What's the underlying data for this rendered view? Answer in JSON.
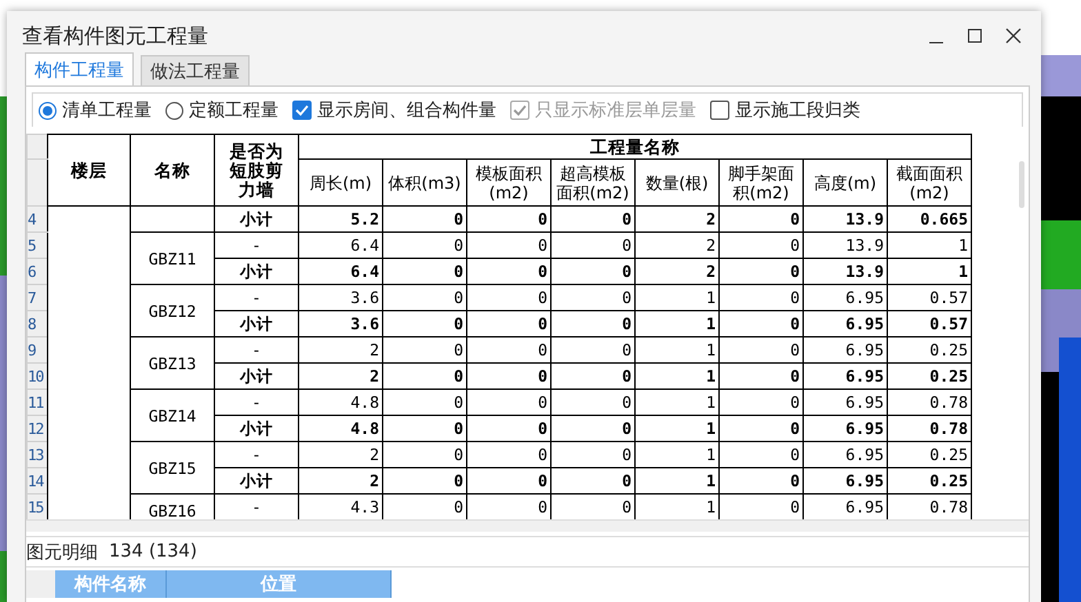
{
  "window": {
    "title": "查看构件图元工程量"
  },
  "tabs": [
    {
      "label": "构件工程量",
      "selected": true
    },
    {
      "label": "做法工程量",
      "selected": false
    }
  ],
  "options": [
    {
      "kind": "radio",
      "label": "清单工程量",
      "checked": true,
      "disabled": false
    },
    {
      "kind": "radio",
      "label": "定额工程量",
      "checked": false,
      "disabled": false
    },
    {
      "kind": "checkbox",
      "label": "显示房间、组合构件量",
      "checked": true,
      "disabled": false
    },
    {
      "kind": "checkbox",
      "label": "只显示标准层单层量",
      "checked": true,
      "disabled": true
    },
    {
      "kind": "checkbox",
      "label": "显示施工段归类",
      "checked": false,
      "disabled": false
    }
  ],
  "table": {
    "fixed_columns": [
      "楼层",
      "名称",
      "是否为短肢剪力墙"
    ],
    "group_heading": "工程量名称",
    "columns": [
      "周长(m)",
      "体积(m3)",
      "模板面积(m2)",
      "超高模板面积(m2)",
      "数量(根)",
      "脚手架面积(m2)",
      "高度(m)",
      "截面面积(m2)"
    ],
    "groups": [
      {
        "rows": [
          {
            "number": "4",
            "kind": "subtotal",
            "type": "小计",
            "values": [
              "5.2",
              "0",
              "0",
              "0",
              "2",
              "0",
              "13.9",
              "0.665"
            ]
          }
        ]
      },
      {
        "name": "GBZ11",
        "rows": [
          {
            "number": "5",
            "kind": "item",
            "type": "-",
            "values": [
              "6.4",
              "0",
              "0",
              "0",
              "2",
              "0",
              "13.9",
              "1"
            ]
          },
          {
            "number": "6",
            "kind": "subtotal",
            "type": "小计",
            "values": [
              "6.4",
              "0",
              "0",
              "0",
              "2",
              "0",
              "13.9",
              "1"
            ]
          }
        ]
      },
      {
        "name": "GBZ12",
        "rows": [
          {
            "number": "7",
            "kind": "item",
            "type": "-",
            "values": [
              "3.6",
              "0",
              "0",
              "0",
              "1",
              "0",
              "6.95",
              "0.57"
            ]
          },
          {
            "number": "8",
            "kind": "subtotal",
            "type": "小计",
            "values": [
              "3.6",
              "0",
              "0",
              "0",
              "1",
              "0",
              "6.95",
              "0.57"
            ]
          }
        ]
      },
      {
        "name": "GBZ13",
        "rows": [
          {
            "number": "9",
            "kind": "item",
            "type": "-",
            "values": [
              "2",
              "0",
              "0",
              "0",
              "1",
              "0",
              "6.95",
              "0.25"
            ]
          },
          {
            "number": "10",
            "kind": "subtotal",
            "type": "小计",
            "values": [
              "2",
              "0",
              "0",
              "0",
              "1",
              "0",
              "6.95",
              "0.25"
            ]
          }
        ]
      },
      {
        "name": "GBZ14",
        "rows": [
          {
            "number": "11",
            "kind": "item",
            "type": "-",
            "values": [
              "4.8",
              "0",
              "0",
              "0",
              "1",
              "0",
              "6.95",
              "0.78"
            ]
          },
          {
            "number": "12",
            "kind": "subtotal",
            "type": "小计",
            "values": [
              "4.8",
              "0",
              "0",
              "0",
              "1",
              "0",
              "6.95",
              "0.78"
            ]
          }
        ]
      },
      {
        "name": "GBZ15",
        "rows": [
          {
            "number": "13",
            "kind": "item",
            "type": "-",
            "values": [
              "2",
              "0",
              "0",
              "0",
              "1",
              "0",
              "6.95",
              "0.25"
            ]
          },
          {
            "number": "14",
            "kind": "subtotal",
            "type": "小计",
            "values": [
              "2",
              "0",
              "0",
              "0",
              "1",
              "0",
              "6.95",
              "0.25"
            ]
          }
        ]
      },
      {
        "name": "GBZ16",
        "rows": [
          {
            "number": "15",
            "kind": "item",
            "type": "-",
            "values": [
              "4.3",
              "0",
              "0",
              "0",
              "1",
              "0",
              "6.95",
              "0.78"
            ]
          }
        ]
      }
    ]
  },
  "detail": {
    "label": "图元明细",
    "count": "134 (134)",
    "columns": [
      "构件名称",
      "位置"
    ]
  }
}
